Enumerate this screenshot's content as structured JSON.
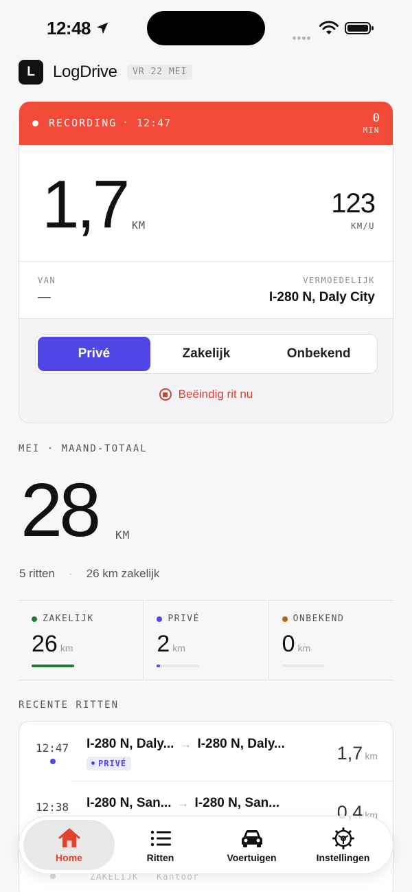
{
  "status_bar": {
    "time": "12:48"
  },
  "header": {
    "logo_letter": "L",
    "app_name": "LogDrive",
    "date": "VR 22 MEI"
  },
  "recording": {
    "label": "RECORDING",
    "separator": "·",
    "time": "12:47",
    "minutes_value": "0",
    "minutes_unit": "MIN",
    "distance_value": "1,7",
    "distance_unit": "KM",
    "speed_value": "123",
    "speed_unit": "KM/U",
    "from_label": "VAN",
    "from_value": "—",
    "to_label": "VERMOEDELIJK",
    "to_value": "I-280 N, Daly City",
    "segments": [
      "Privé",
      "Zakelijk",
      "Onbekend"
    ],
    "selected_segment": "Privé",
    "end_trip_label": "Beëindig rit nu"
  },
  "month": {
    "title": "MEI · MAAND-TOTAAL",
    "total_value": "28",
    "total_unit": "KM",
    "trips_count": "5 ritten",
    "business_summary": "26 km zakelijk",
    "dot_separator": "·",
    "stats": [
      {
        "label": "ZAKELIJK",
        "value": "26",
        "unit": "km",
        "color": "#1e7a35",
        "fill_fraction": 1.0
      },
      {
        "label": "PRIVÉ",
        "value": "2",
        "unit": "km",
        "color": "#5046e5",
        "fill_fraction": 0.08
      },
      {
        "label": "ONBEKEND",
        "value": "0",
        "unit": "km",
        "color": "#b8641a",
        "fill_fraction": 0.0
      }
    ]
  },
  "recent": {
    "title": "RECENTE RITTEN",
    "trips": [
      {
        "time": "12:47",
        "from": "I-280 N, Daly...",
        "to": "I-280 N, Daly...",
        "tag": "PRIVÉ",
        "distance": "1,7",
        "unit": "km"
      },
      {
        "time": "12:38",
        "from": "I-280 N, San...",
        "to": "I-280 N, San...",
        "tag": "",
        "distance": "0,4",
        "unit": "km"
      }
    ],
    "partial_row_tag": "ZAKELIJK",
    "partial_row_note": "Kantoor"
  },
  "tabs": [
    {
      "label": "Home",
      "icon": "home-icon"
    },
    {
      "label": "Ritten",
      "icon": "list-icon"
    },
    {
      "label": "Voertuigen",
      "icon": "car-icon"
    },
    {
      "label": "Instellingen",
      "icon": "gear-icon"
    }
  ],
  "active_tab": "Home",
  "colors": {
    "recording_red": "#f24a38",
    "accent_purple": "#5046e5",
    "end_trip_red": "#d6402f",
    "active_tab_red": "#e2422d",
    "business_green": "#1e7a35",
    "unknown_orange": "#b8641a"
  }
}
